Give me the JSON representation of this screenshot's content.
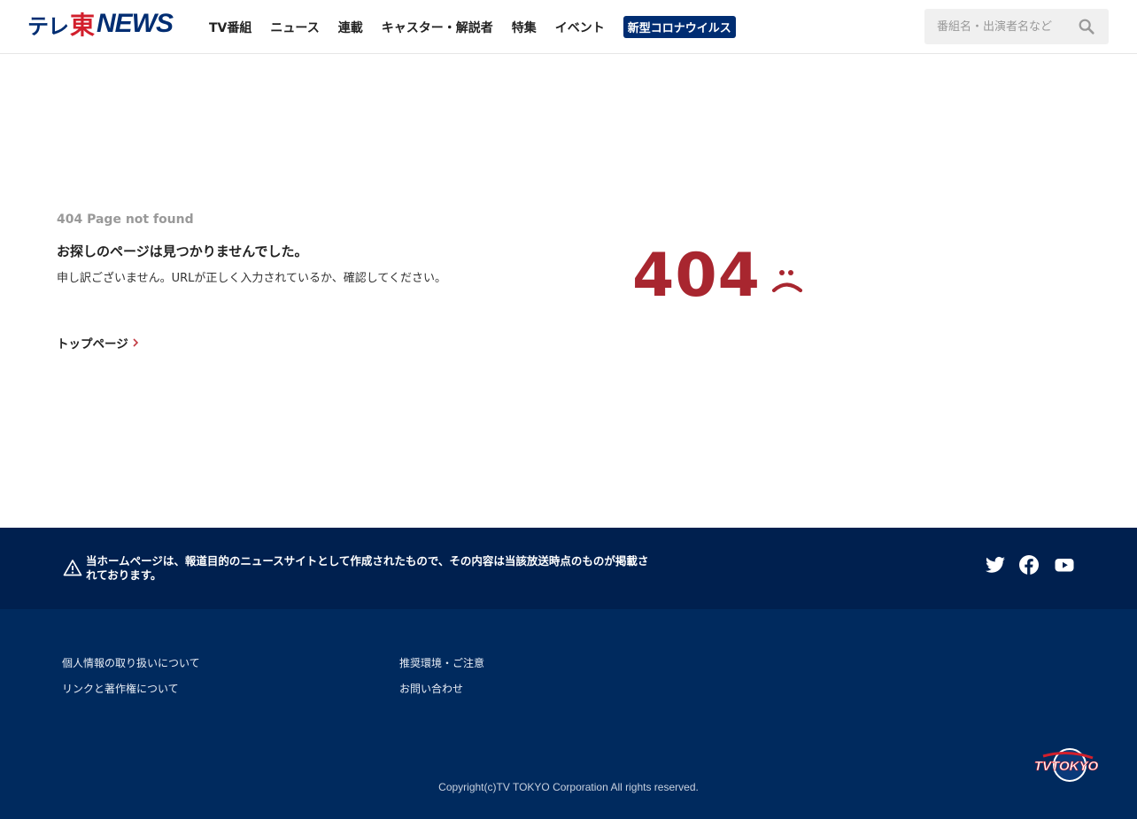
{
  "header": {
    "logo": {
      "part1": "テレ",
      "part2": "東",
      "part3": "NEWS"
    },
    "nav": [
      {
        "label": "TV番組"
      },
      {
        "label": "ニュース"
      },
      {
        "label": "連載"
      },
      {
        "label": "キャスター・解説者"
      },
      {
        "label": "特集"
      },
      {
        "label": "イベント"
      }
    ],
    "badge": "新型コロナウイルス",
    "search": {
      "placeholder": "番組名・出演者名など",
      "value": "",
      "icon": "search-icon"
    }
  },
  "main": {
    "code": "404 Page not found",
    "title": "お探しのページは見つかりませんでした。",
    "description": "申し訳ございません。URLが正しく入力されているか、確認してください。",
    "top_link": "トップページ",
    "big_number": "404",
    "accent_color": "#a8262f"
  },
  "notice": {
    "text": "当ホームページは、報道目的のニュースサイトとして作成されたもので、その内容は当該放送時点のものが掲載されております。",
    "icons": [
      "warning-icon",
      "twitter-icon",
      "facebook-icon",
      "youtube-icon"
    ]
  },
  "footer": {
    "links": [
      {
        "label": "個人情報の取り扱いについて"
      },
      {
        "label": "推奨環境・ご注意"
      },
      {
        "label": "リンクと著作権について"
      },
      {
        "label": "お問い合わせ"
      }
    ],
    "logo_text": "TVTOKYO",
    "copyright": "Copyright(c)TV TOKYO Corporation All rights reserved."
  },
  "colors": {
    "brand_navy": "#002d72",
    "brand_red": "#d21f2c",
    "notice_bg": "#00204f",
    "footer_bg": "#002a5e"
  }
}
